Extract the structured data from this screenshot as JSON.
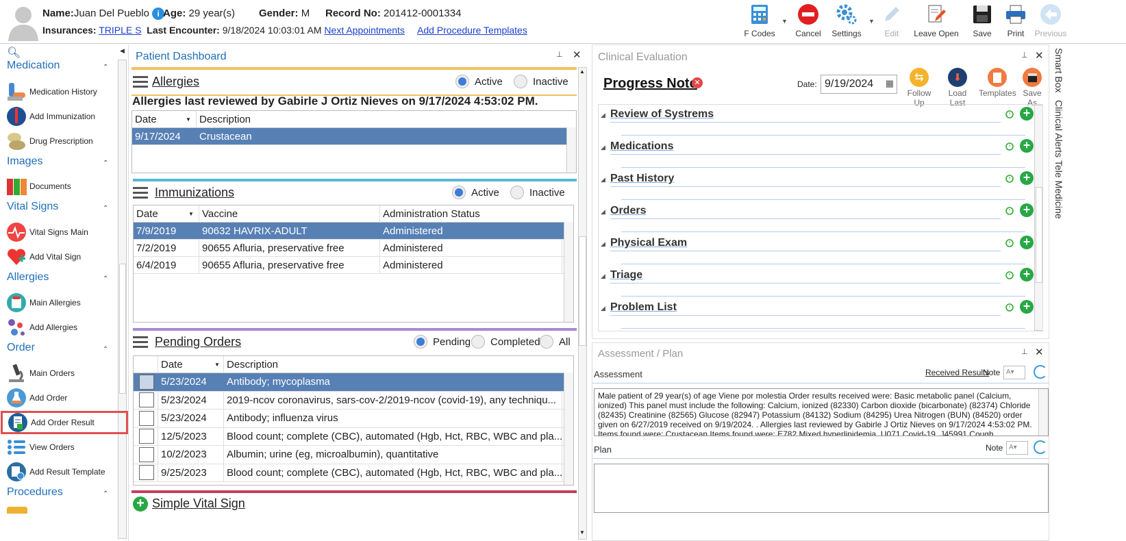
{
  "header": {
    "name_label": "Name:",
    "name": "Juan Del Pueblo",
    "age_label": "Age:",
    "age": "29 year(s)",
    "gender_label": "Gender:",
    "gender": "M",
    "record_label": "Record No:",
    "record": "201412-0001334",
    "insurances_label": "Insurances:",
    "insurance": "TRIPLE S",
    "last_enc_label": "Last Encounter:",
    "last_enc": "9/18/2024 10:03:01 AM",
    "next_appointments": "Next Appointments",
    "add_procedure_templates": "Add Procedure Templates"
  },
  "toolbar": {
    "fcodes": "F Codes",
    "cancel": "Cancel",
    "settings": "Settings",
    "edit": "Edit",
    "leave_open": "Leave Open",
    "save": "Save",
    "print": "Print",
    "previous": "Previous"
  },
  "sidebar": {
    "sections": [
      {
        "title": "Medication",
        "items": [
          "Medication History",
          "Add Immunization",
          "Drug Prescription"
        ]
      },
      {
        "title": "Images",
        "items": [
          "Documents"
        ]
      },
      {
        "title": "Vital Signs",
        "items": [
          "Vital Signs Main",
          "Add Vital Sign"
        ]
      },
      {
        "title": "Allergies",
        "items": [
          "Main Allergies",
          "Add Allergies"
        ]
      },
      {
        "title": "Order",
        "items": [
          "Main Orders",
          "Add Order",
          "Add Order Result",
          "View Orders",
          "Add Result Template"
        ]
      },
      {
        "title": "Procedures",
        "items": []
      }
    ]
  },
  "dashboard": {
    "title": "Patient Dashboard",
    "allergies": {
      "title": "Allergies",
      "active": "Active",
      "inactive": "Inactive",
      "reviewed": "Allergies last reviewed by Gabirle J Ortiz Nieves on 9/17/2024 4:53:02 PM.",
      "cols": [
        "Date",
        "Description"
      ],
      "rows": [
        [
          "9/17/2024",
          "Crustacean"
        ]
      ]
    },
    "immunizations": {
      "title": "Immunizations",
      "active": "Active",
      "inactive": "Inactive",
      "cols": [
        "Date",
        "Vaccine",
        "Administration Status"
      ],
      "rows": [
        [
          "7/9/2019",
          "90632 HAVRIX-ADULT",
          "Administered"
        ],
        [
          "7/2/2019",
          "90655 Afluria, preservative free",
          "Administered"
        ],
        [
          "6/4/2019",
          "90655 Afluria, preservative free",
          "Administered"
        ]
      ]
    },
    "pending": {
      "title": "Pending Orders",
      "pending": "Pending",
      "completed": "Completed",
      "all": "All",
      "cols": [
        "Date",
        "Description"
      ],
      "rows": [
        [
          "5/23/2024",
          "Antibody; mycoplasma"
        ],
        [
          "5/23/2024",
          "2019-ncov coronavirus, sars-cov-2/2019-ncov (covid-19), any techniqu..."
        ],
        [
          "5/23/2024",
          "Antibody; influenza virus"
        ],
        [
          "12/5/2023",
          "Blood count; complete (CBC), automated (Hgb, Hct, RBC, WBC and pla..."
        ],
        [
          "10/2/2023",
          "Albumin; urine (eg, microalbumin), quantitative"
        ],
        [
          "9/25/2023",
          "Blood count; complete (CBC), automated (Hgb, Hct, RBC, WBC and pla..."
        ]
      ]
    },
    "simple_vital": "Simple Vital Sign"
  },
  "clinical": {
    "title": "Clinical Evaluation",
    "note_title": "Progress Note",
    "date_label": "Date:",
    "date": "9/19/2024",
    "buttons": [
      "Follow Up",
      "Load Last",
      "Templates",
      "Save As"
    ],
    "sections": [
      "Review of Systrems",
      "Medications",
      "Past History",
      "Orders",
      "Physical Exam",
      "Triage",
      "Problem List"
    ]
  },
  "assessment": {
    "title": "Assessment / Plan",
    "assessment_label": "Assessment",
    "received_results": "Received Results",
    "note": "Note",
    "plan_label": "Plan",
    "plan_note": "Note",
    "text": "Male patient of 29 year(s) of age Viene por molestia   Order results received were: Basic metabolic panel (Calcium, ionized) This panel must include the following: Calcium, ionized (82330) Carbon dioxide (bicarbonate) (82374) Chloride (82435) Creatinine (82565) Glucose (82947) Potassium (84132) Sodium (84295) Urea Nitrogen (BUN) (84520) order given on 6/27/2019 received on 9/19/2024. .  Allergies last reviewed by Gabirle J Ortiz Nieves on 9/17/2024 4:53:02 PM.    Items found were:  Crustacean  Items found were:  E782 Mixed hyperlipidemia, U071 Covid-19, J45991 Cough"
  },
  "rail": [
    "Smart Box",
    "Clinical Alerts",
    "Tele Medicine"
  ]
}
